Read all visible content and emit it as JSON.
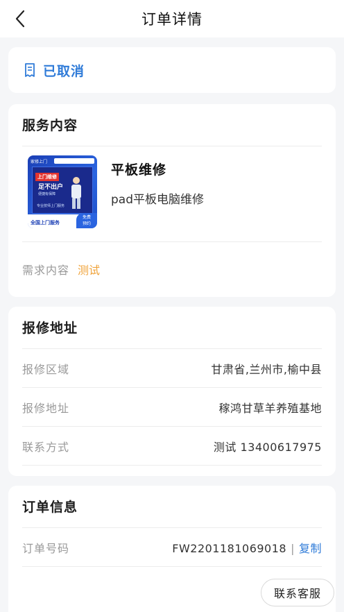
{
  "nav": {
    "title": "订单详情"
  },
  "status": {
    "text": "已取消",
    "color": "#2f7bd8"
  },
  "service": {
    "section_title": "服务内容",
    "name": "平板维修",
    "desc": "pad平板电脑维修",
    "demand_label": "需求内容",
    "demand_value": "测试",
    "thumb": {
      "top_text": "家修上门",
      "label": "上门维修",
      "big_text_1": "足不出户",
      "big_text_2": "便捷有保障",
      "small_text": "专业技师上门服务",
      "footer_text": "全国上门服务",
      "badge_1": "免费",
      "badge_2": "预约"
    }
  },
  "address": {
    "section_title": "报修地址",
    "rows": [
      {
        "label": "报修区域",
        "value": "甘肃省,兰州市,榆中县"
      },
      {
        "label": "报修地址",
        "value": "稼鸿甘草羊养殖基地"
      },
      {
        "label": "联系方式",
        "value": "测试 13400617975"
      }
    ]
  },
  "order": {
    "section_title": "订单信息",
    "number_label": "订单号码",
    "number_value": "FW2201181069018",
    "separator": "|",
    "copy_label": "复制"
  },
  "contact_button": "联系客服",
  "colors": {
    "accent": "#2f7bd8",
    "demand": "#f0a33a",
    "background": "#f5f6f8"
  },
  "icons": {
    "back": "chevron-left-icon",
    "status": "document-icon"
  }
}
